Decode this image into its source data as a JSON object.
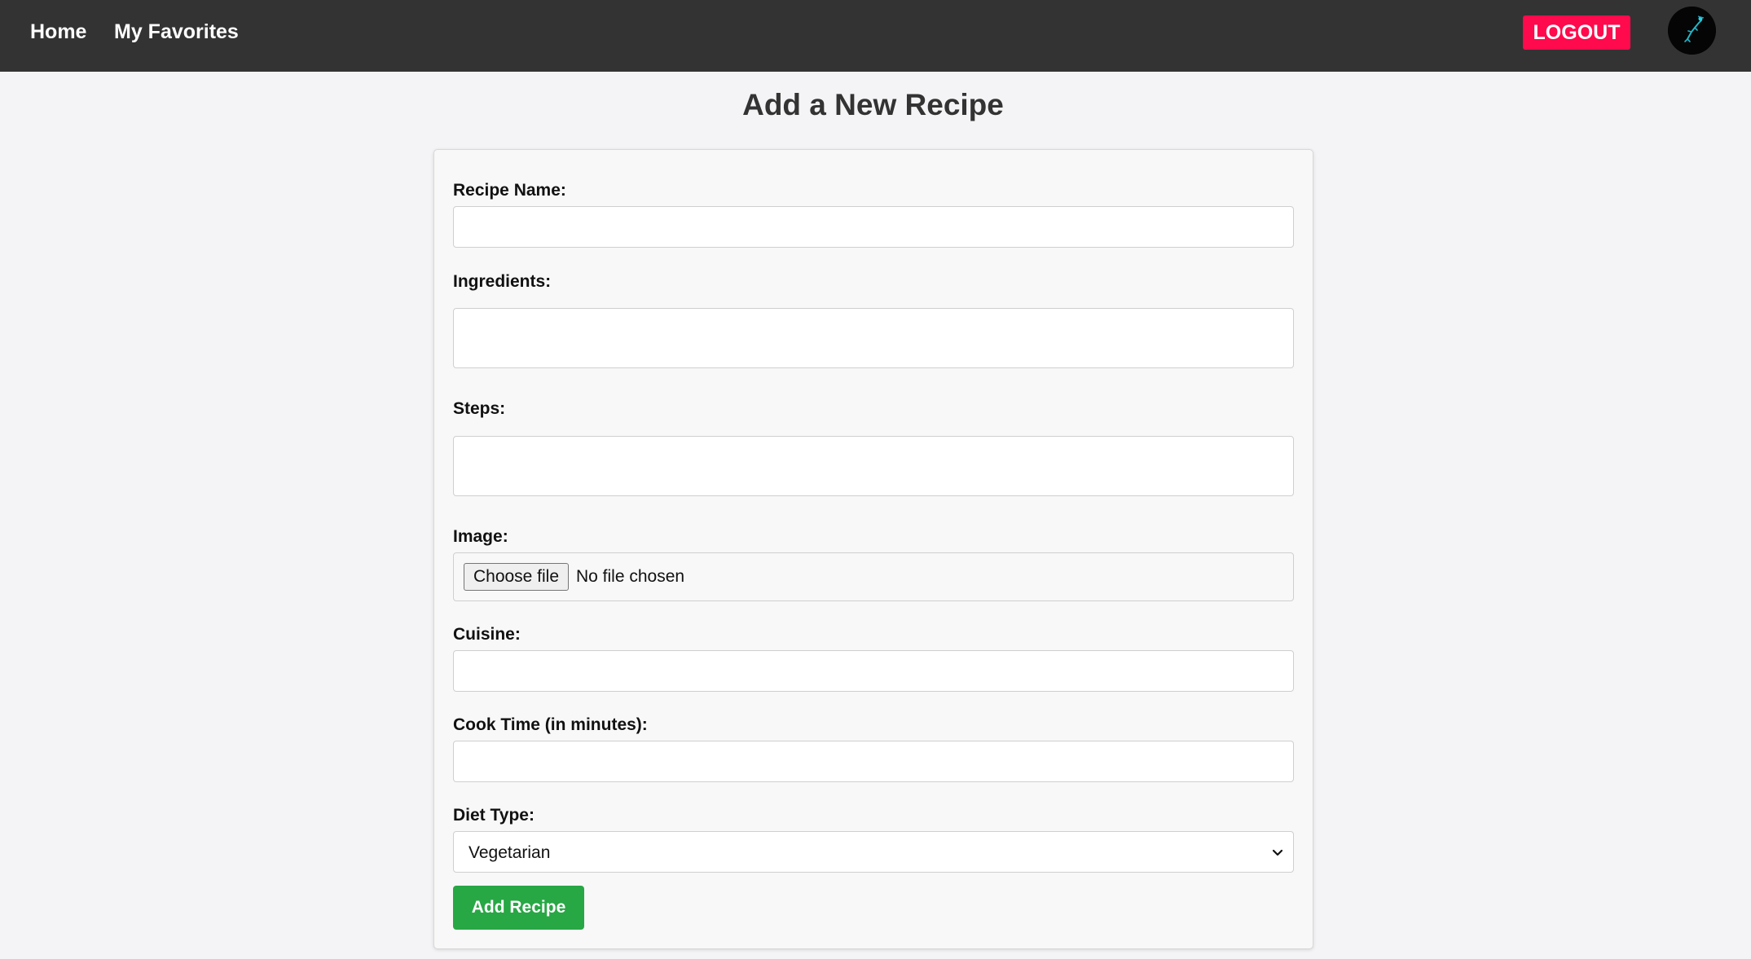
{
  "nav": {
    "home_label": "Home",
    "favorites_label": "My Favorites",
    "logout_label": "LOGOUT",
    "avatar_icon": "user-avatar-icon"
  },
  "page": {
    "title": "Add a New Recipe"
  },
  "form": {
    "recipe_name": {
      "label": "Recipe Name:",
      "value": ""
    },
    "ingredients": {
      "label": "Ingredients:",
      "value": ""
    },
    "steps": {
      "label": "Steps:",
      "value": ""
    },
    "image": {
      "label": "Image:",
      "button_label": "Choose file",
      "status": "No file chosen"
    },
    "cuisine": {
      "label": "Cuisine:",
      "value": ""
    },
    "cook_time": {
      "label": "Cook Time (in minutes):",
      "value": ""
    },
    "diet_type": {
      "label": "Diet Type:",
      "selected": "Vegetarian"
    },
    "submit_label": "Add Recipe"
  },
  "colors": {
    "navbar": "#333333",
    "logout": "#ff0a4c",
    "submit": "#28a745",
    "page_bg": "#f4f4f6"
  }
}
